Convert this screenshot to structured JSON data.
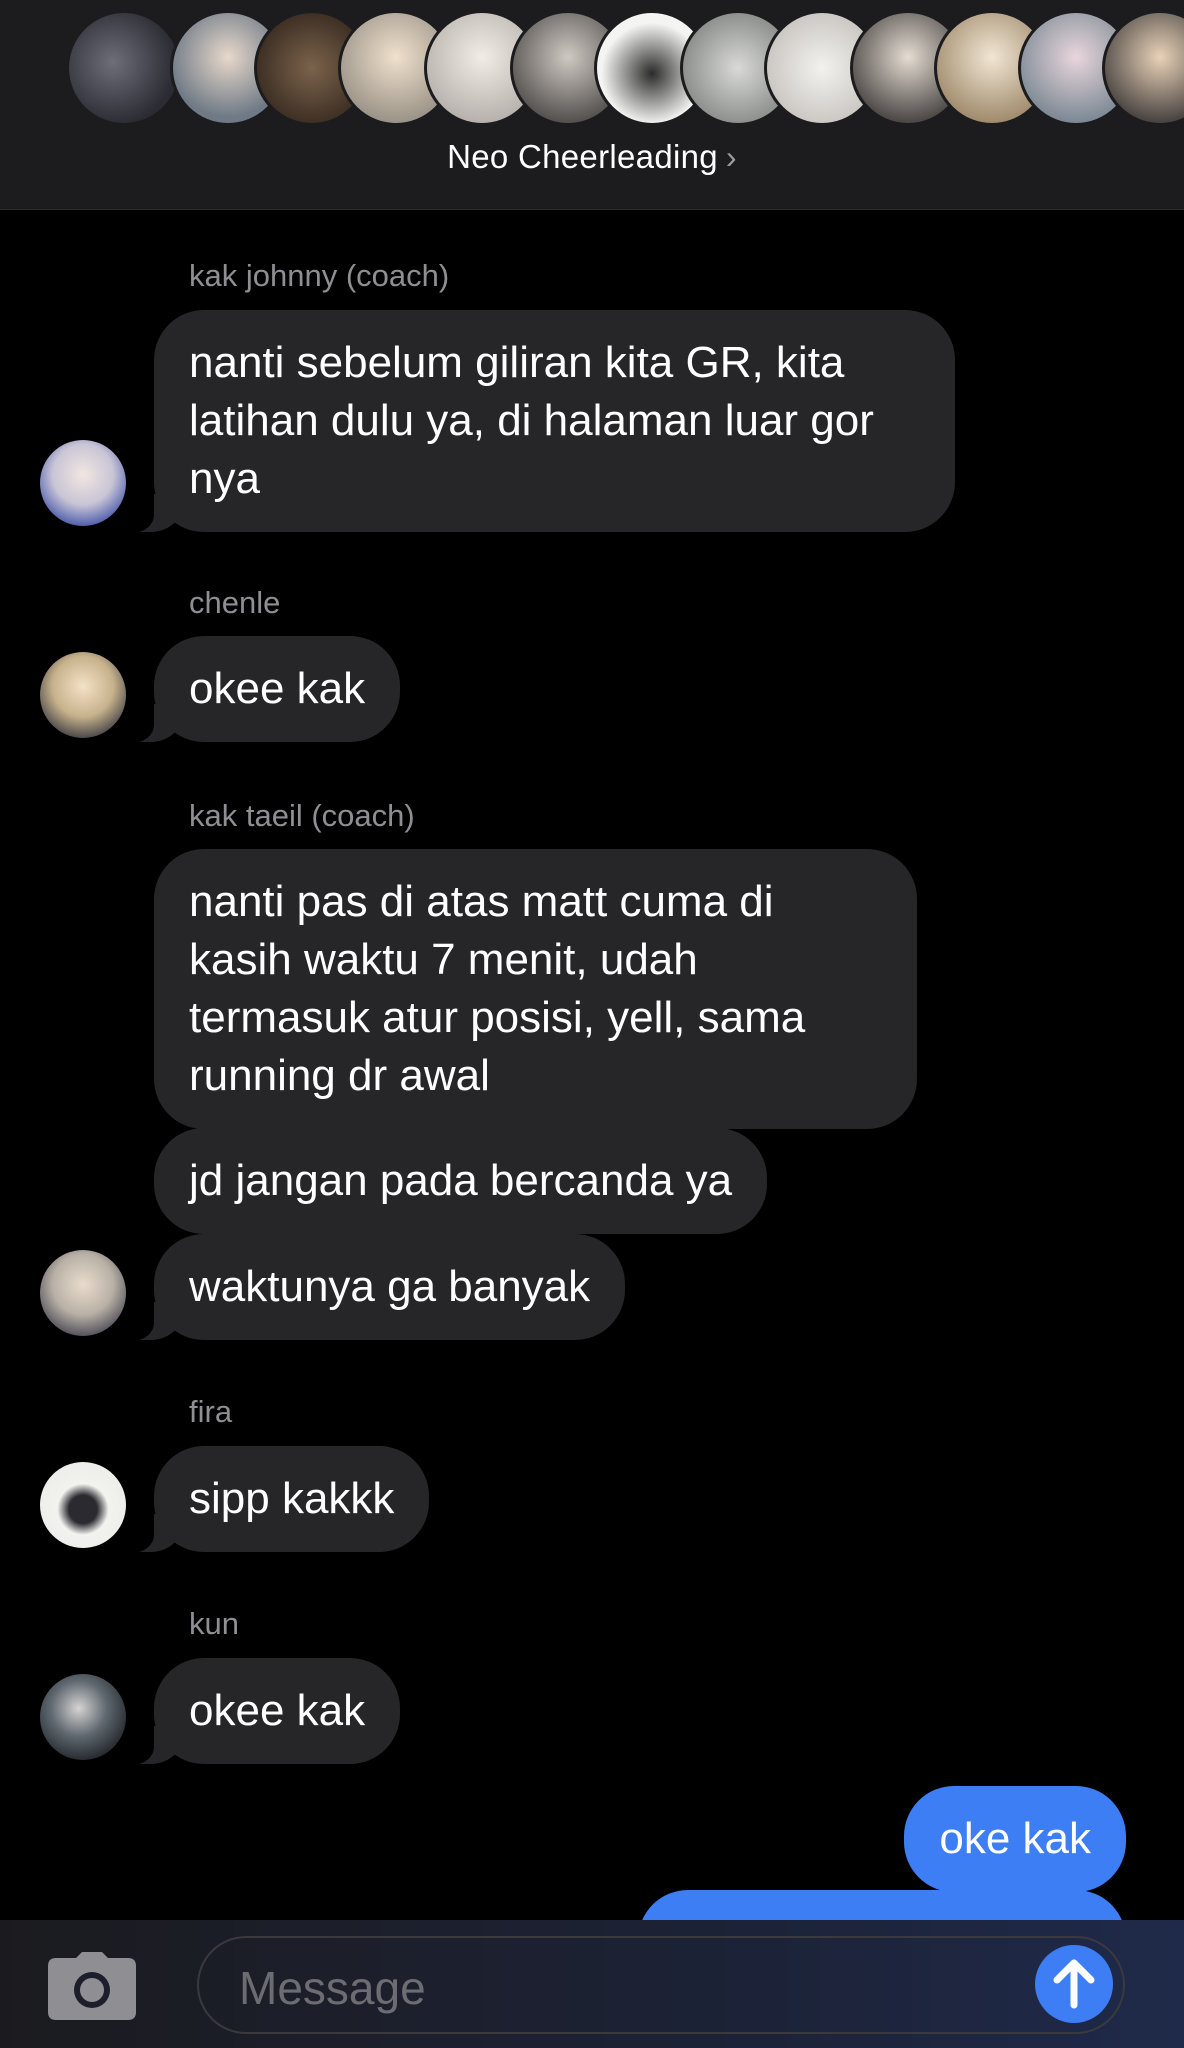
{
  "header": {
    "group_name": "Neo Cheerleading",
    "chevron_icon": "chevron-right-icon",
    "member_avatar_colors": [
      "#3b3d47",
      "#7a8590",
      "#5a4a3e",
      "#cfc6bd",
      "#d8d4d0",
      "#8d8b88",
      "#ededea",
      "#b3b4b2",
      "#e4e2df",
      "#a59f9a",
      "#cbb89d",
      "#b7aeb6",
      "#615c5a"
    ]
  },
  "messages": [
    {
      "sender": "kak johnny (coach)",
      "text": "nanti sebelum giliran kita GR, kita latihan dulu ya, di halaman luar gor nya",
      "avatar_color": "#a9b4d8"
    },
    {
      "sender": "chenle",
      "text": "okee kak",
      "avatar_color": "#c7b28c"
    },
    {
      "sender": "kak taeil (coach)",
      "texts": [
        "nanti pas di atas matt cuma di kasih waktu 7 menit, udah termasuk atur posisi, yell, sama running dr awal",
        "jd jangan pada bercanda ya",
        "waktunya ga banyak"
      ],
      "avatar_color": "#b9b1a6"
    },
    {
      "sender": "fira",
      "text": "sipp kakkk",
      "avatar_color": "#e9e9e6"
    },
    {
      "sender": "kun",
      "text": "okee kak",
      "avatar_color": "#3f4a52"
    }
  ],
  "outgoing": [
    {
      "text": "oke kak"
    }
  ],
  "composer": {
    "placeholder": "Message",
    "camera_icon": "camera-icon",
    "send_icon": "arrow-up-icon"
  },
  "colors": {
    "background": "#000000",
    "incoming_bubble": "#262628",
    "outgoing_bubble": "#3d7ef5",
    "sender_label": "#8e8e93"
  }
}
